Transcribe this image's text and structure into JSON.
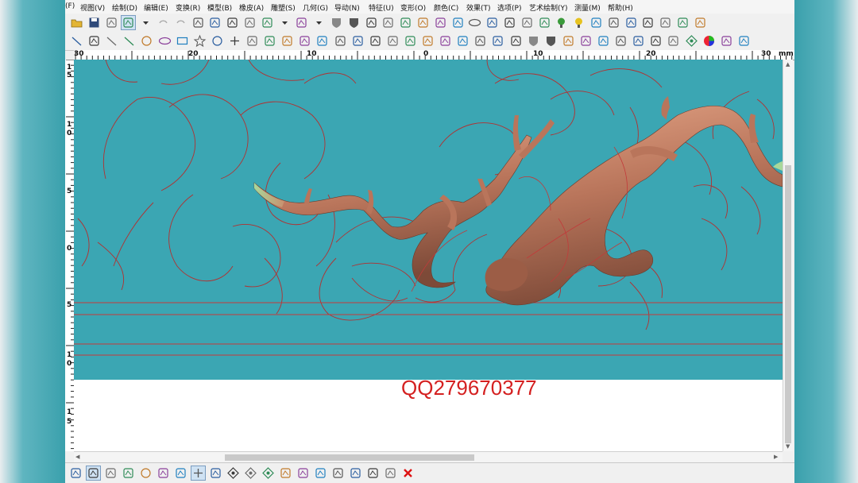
{
  "menu": {
    "items": [
      "(F)",
      "视图(V)",
      "绘制(D)",
      "编辑(E)",
      "变换(R)",
      "模型(B)",
      "橡皮(A)",
      "雕塑(S)",
      "几何(G)",
      "导动(N)",
      "特征(U)",
      "变形(O)",
      "颜色(C)",
      "效果(T)",
      "选项(P)",
      "艺术绘制(Y)",
      "测量(M)",
      "帮助(H)"
    ]
  },
  "ruler": {
    "horizontal_labels": [
      "30",
      "20",
      "10",
      "0",
      "10",
      "20",
      "30",
      "mm"
    ],
    "vertical_labels": [
      "1",
      "5",
      "1",
      "0",
      "5",
      "0",
      "5",
      "1",
      "0",
      "1",
      "5"
    ]
  },
  "watermark": {
    "text": "QQ279670377"
  },
  "toolbar1_icons": [
    "open-folder-icon",
    "save-icon",
    "select-cross-icon",
    "select-box-icon",
    "dropdown-icon",
    "undo-icon",
    "redo-icon",
    "delete-icon",
    "cut-icon",
    "copy-icon",
    "paste-icon",
    "cube-view-icon",
    "dropdown-icon",
    "box-view-icon",
    "dropdown-icon",
    "shield-icon",
    "shield-dark-icon",
    "trim-icon",
    "extend-icon",
    "fillet-icon",
    "chamfer-icon",
    "offset-icon",
    "curve-edit-icon",
    "ellipse-tool-icon",
    "grid-icon",
    "node-icon",
    "node-edit-icon",
    "node-merge-icon",
    "bulb-green-icon",
    "bulb-yellow-icon",
    "color-balls-icon",
    "color-dots-icon",
    "small-tool-icon",
    "small-tool-2-icon",
    "book-icon",
    "keyboard-icon",
    "settings-icon"
  ],
  "toolbar2_icons": [
    "line-icon",
    "arc-icon",
    "spline-icon",
    "polyline-icon",
    "circle-target-icon",
    "ellipse-icon",
    "rectangle-icon",
    "star-icon",
    "circle-icon",
    "point-icon",
    "dimension-icon",
    "step-icon",
    "step-2-icon",
    "step-3-icon",
    "spiral-icon",
    "align-icon",
    "align-2-icon",
    "gear-icon",
    "array-icon",
    "array-2-icon",
    "mirror-icon",
    "transform-icon",
    "grid-2-icon",
    "sparkle-icon",
    "node-box-icon",
    "node-box-2-icon",
    "shield-icon",
    "shield-dark-icon",
    "sculpt-icon",
    "sculpt-2-icon",
    "eraser-icon",
    "bowl-icon",
    "funnel-icon",
    "relief-icon",
    "mound-icon",
    "diamond-icon",
    "color-wheel-icon",
    "texture-icon",
    "recycle-icon"
  ],
  "bottom_icons": [
    "snap-grid-icon",
    "snap-curve-icon",
    "snap-intersect-icon",
    "snap-tangent-icon",
    "snap-circle-icon",
    "snap-perpendicular-icon",
    "snap-angle-icon",
    "snap-point-icon",
    "snap-on-icon",
    "diamond-snap-icon",
    "diamond-snap-2-icon",
    "diamond-snap-3-icon",
    "layer-icon",
    "layer-2-icon",
    "pick-icon",
    "pick-x-icon",
    "rotate-view-icon",
    "zoom-icon",
    "zoom-window-icon",
    "close-red-icon"
  ]
}
